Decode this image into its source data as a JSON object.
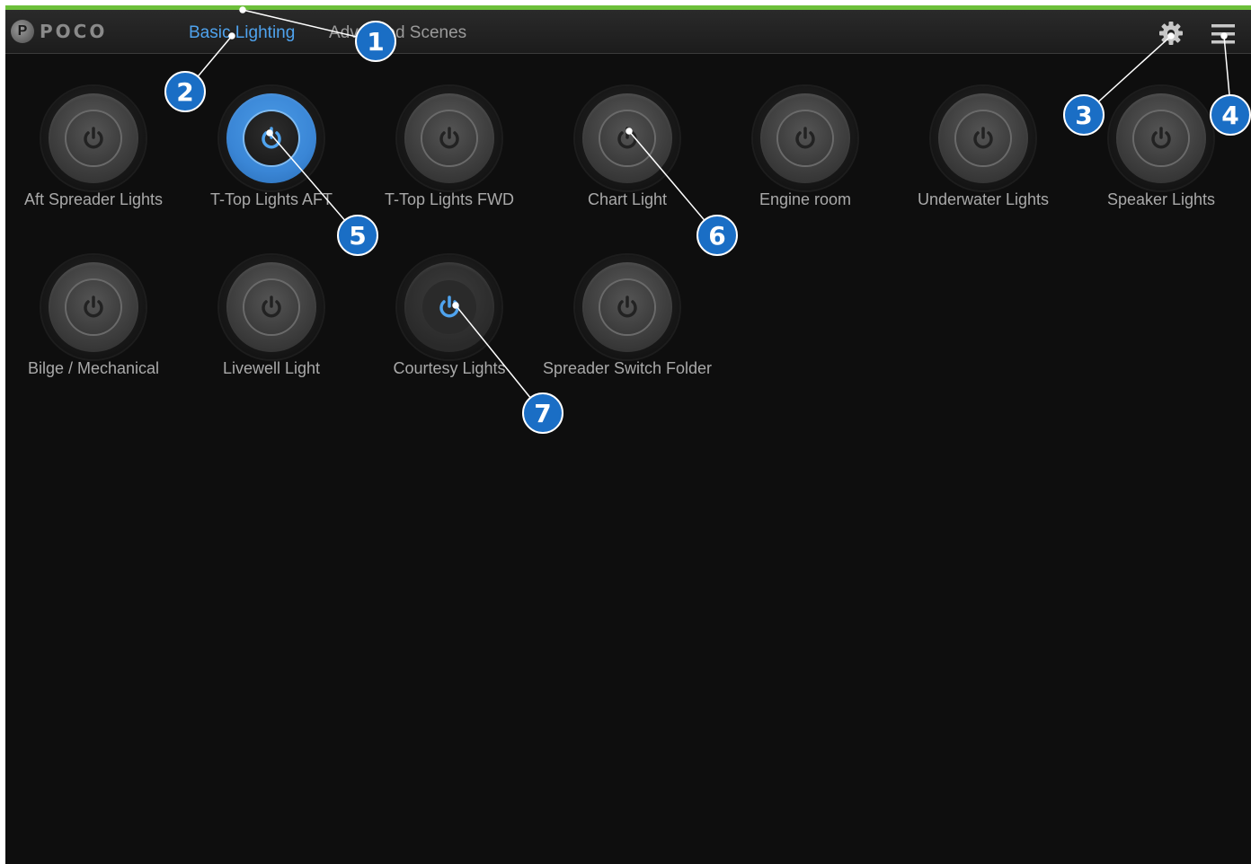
{
  "app": {
    "logo_text": "POCO",
    "accent_color": "#6cbf3a",
    "active_color": "#4fa3ee"
  },
  "tabs": [
    {
      "label": "Basic Lighting",
      "active": true
    },
    {
      "label": "Advanced Scenes",
      "active": false
    }
  ],
  "toolbar": {
    "settings_icon": "gear-icon",
    "menu_icon": "hamburger-menu-icon"
  },
  "switches": [
    {
      "label": "Aft Spreader Lights",
      "state": "off"
    },
    {
      "label": "T-Top Lights AFT",
      "state": "on"
    },
    {
      "label": "T-Top Lights FWD",
      "state": "off"
    },
    {
      "label": "Chart Light",
      "state": "off"
    },
    {
      "label": "Engine room",
      "state": "off"
    },
    {
      "label": "Underwater Lights",
      "state": "off"
    },
    {
      "label": "Speaker Lights",
      "state": "off"
    },
    {
      "label": "Bilge / Mechanical",
      "state": "off"
    },
    {
      "label": "Livewell Light",
      "state": "off"
    },
    {
      "label": "Courtesy Lights",
      "state": "on-dim"
    },
    {
      "label": "Spreader Switch Folder",
      "state": "off"
    }
  ],
  "callouts": [
    "1",
    "2",
    "3",
    "4",
    "5",
    "6",
    "7"
  ]
}
